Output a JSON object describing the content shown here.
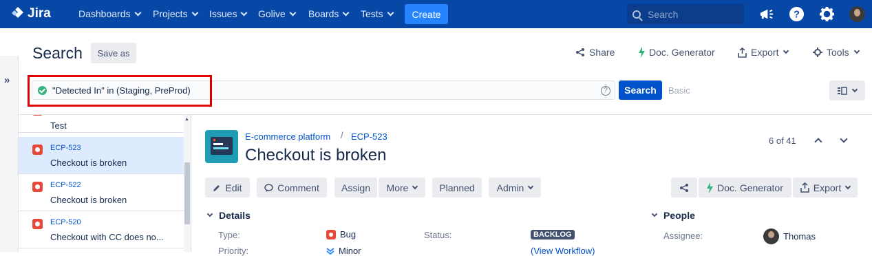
{
  "topnav": {
    "logo_text": "Jira",
    "items": [
      {
        "label": "Dashboards"
      },
      {
        "label": "Projects"
      },
      {
        "label": "Issues"
      },
      {
        "label": "Golive"
      },
      {
        "label": "Boards"
      },
      {
        "label": "Tests"
      }
    ],
    "create_label": "Create",
    "search_placeholder": "Search",
    "icons": [
      "notifications-megaphone-icon",
      "help-icon",
      "settings-gear-icon",
      "user-avatar"
    ]
  },
  "header": {
    "title": "Search",
    "save_as_label": "Save as",
    "actions": {
      "share": "Share",
      "doc_generator": "Doc. Generator",
      "export": "Export",
      "tools": "Tools"
    }
  },
  "jql": {
    "query": "\"Detected In\" in (Staging, PreProd)",
    "search_label": "Search",
    "basic_label": "Basic"
  },
  "issue_list": [
    {
      "key": "",
      "summary": "Test",
      "selected": false
    },
    {
      "key": "ECP-523",
      "summary": "Checkout is broken",
      "selected": true
    },
    {
      "key": "ECP-522",
      "summary": "Checkout is broken",
      "selected": false
    },
    {
      "key": "ECP-520",
      "summary": "Checkout with CC does no...",
      "selected": false
    }
  ],
  "issue": {
    "project": "E-commerce platform",
    "separator": "/",
    "key": "ECP-523",
    "title": "Checkout is broken",
    "pager": "6 of 41",
    "buttons": {
      "edit": "Edit",
      "comment": "Comment",
      "assign": "Assign",
      "more": "More",
      "planned": "Planned",
      "admin": "Admin",
      "doc_generator": "Doc. Generator",
      "export": "Export"
    },
    "details": {
      "header": "Details",
      "type_label": "Type:",
      "type_value": "Bug",
      "status_label": "Status:",
      "status_value": "BACKLOG",
      "priority_label": "Priority:",
      "priority_value": "Minor",
      "workflow_link": "(View Workflow)"
    },
    "people": {
      "header": "People",
      "assignee_label": "Assignee:",
      "assignee_value": "Thomas"
    }
  },
  "colors": {
    "nav_bg": "#0747a6",
    "primary": "#0052cc",
    "create_bg": "#2684ff",
    "bug": "#e5493a",
    "highlight": "#e00000",
    "selected_row": "#deebff"
  }
}
